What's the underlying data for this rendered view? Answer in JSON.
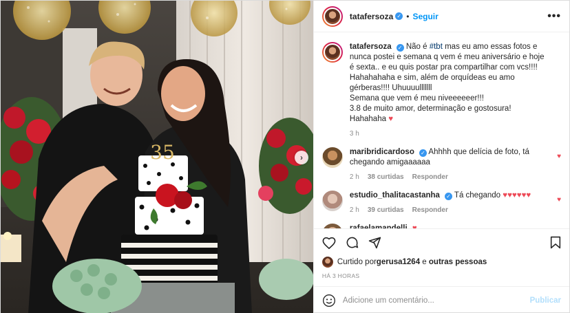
{
  "post": {
    "username": "tatafersoza",
    "follow_label": "Seguir",
    "more_label": "•••",
    "caption_user": "tatafersoza",
    "caption_pre": "Não é ",
    "caption_tag": "#tbt",
    "caption_text": " mas eu amo essas fotos e nunca postei e semana q vem é meu aniversário e hoje é sexta.. e eu quis postar pra compartilhar com vcs!!!! Hahahahaha e sim, além de orquídeas eu amo gérberas!!!! Uhuuuulllllll",
    "caption_line2": "Semana que vem é meu niveeeeeer!!!",
    "caption_line3": "3.8 de muito amor, determinação e gostosura! Hahahaha",
    "caption_time": "3 h",
    "cake_number": "35"
  },
  "comments": [
    {
      "username": "maribridicardoso",
      "text": "Ahhhh que delícia de foto, tá chegando amigaaaaaa",
      "time": "2 h",
      "likes": "38 curtidas",
      "reply": "Responder",
      "liked": true
    },
    {
      "username": "estudio_thalitacastanha",
      "text": "Tá chegando",
      "hearts": "♥♥♥♥♥♥",
      "time": "2 h",
      "likes": "39 curtidas",
      "reply": "Responder",
      "liked": true
    },
    {
      "username": "rafaelamandelli",
      "text": "",
      "hearts": "♥",
      "liked": false
    }
  ],
  "liked_by": {
    "prefix": "Curtido por ",
    "user": "gerusa1264",
    "middle": " e ",
    "others": "outras pessoas"
  },
  "timestamp": "HÁ 3 HORAS",
  "comment_box": {
    "placeholder": "Adicione um comentário...",
    "publish_label": "Publicar"
  },
  "colors": {
    "accent": "#0095f6",
    "heart": "#ed4956",
    "muted": "#8e8e8e",
    "verified": "#3897f0"
  }
}
